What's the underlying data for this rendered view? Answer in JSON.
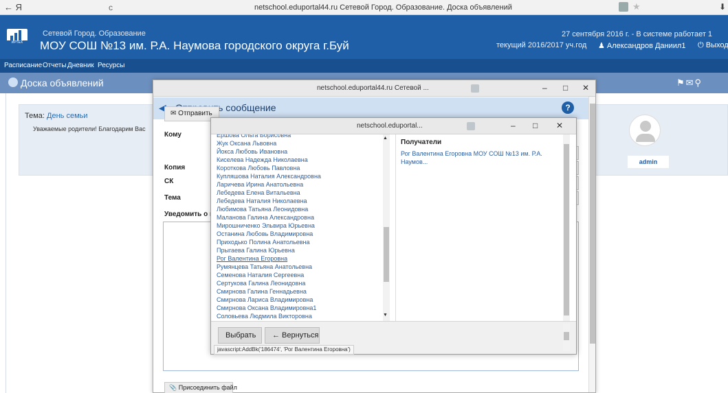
{
  "browser": {
    "nav": "← Я",
    "reload": "c",
    "title": "netschool.eduportal44.ru  Сетевой Город. Образование. Доска объявлений",
    "download": "⬇"
  },
  "header": {
    "org_sub": "Сетевой Город. Образование",
    "org_main": "МОУ СОШ №13 им. Р.А. Наумова городского округа г.Буй",
    "logo_text": "ИРТЕХ",
    "date": "27 сентября 2016 г. - В системе работает 1",
    "year": "текущий 2016/2017 уч.год",
    "user": "Александров Даниил1",
    "logout": "Выход"
  },
  "menu": {
    "items": [
      "Расписание",
      "Отчеты",
      "Дневник",
      "Ресурсы"
    ]
  },
  "page": {
    "title": "Доска объявлений",
    "announcement_label": "Тема: ",
    "announcement_topic": "День семьи",
    "announcement_body": "Уважаемые родители! Благодарим Вас",
    "admin": "admin"
  },
  "compose": {
    "window_title": "netschool.eduportal44.ru  Сетевой ...",
    "header": "Отправить сообщение",
    "send_label": "Отправить",
    "to_label": "Кому",
    "cc_label": "Копия",
    "bcc_label": "СК",
    "subject_label": "Тема",
    "notify_label": "Уведомить о пр",
    "attach_label": "Присоединить файл"
  },
  "picker": {
    "window_title": "netschool.eduportal...",
    "contacts": [
      "Ершова Ольга Борисовна",
      "Жук Оксана Львовна",
      "Йокса Любовь Ивановна",
      "Киселева Надежда Николаевна",
      "Короткова Любовь Павловна",
      "Купляшова Наталия Александровна",
      "Ларичева Ирина Анатольевна",
      "Лебедева Елена Витальевна",
      "Лебедева Наталия Николаевна",
      "Любимова Татьяна Леонидовна",
      "Маланова Галина Александровна",
      "Мирошниченко Эльвира Юрьевна",
      "Останина Любовь Владимировна",
      "Приходько Полина Анатольевна",
      "Прыгаева Галина Юрьевна",
      "Рог Валентина Егоровна",
      "Румянцева Татьяна Анатольевна",
      "Семенова Наталия Сергеевна",
      "Сертукова Галина Леонидовна",
      "Смирнова Галина Геннадьевна",
      "Смирнова Лариса Владимировна",
      "Смирнова Оксана Владимировна1",
      "Соловьева Людмила Викторовна"
    ],
    "selected_index": 15,
    "recipients_title": "Получатели",
    "recipient": "Рог Валентина Егоровна МОУ СОШ №13 им. Р.А. Наумов...",
    "select_button": "Выбрать",
    "back_button": "← Вернуться",
    "status": "javascript:AddBk('186474', 'Рог Валентина Егоровна')"
  }
}
